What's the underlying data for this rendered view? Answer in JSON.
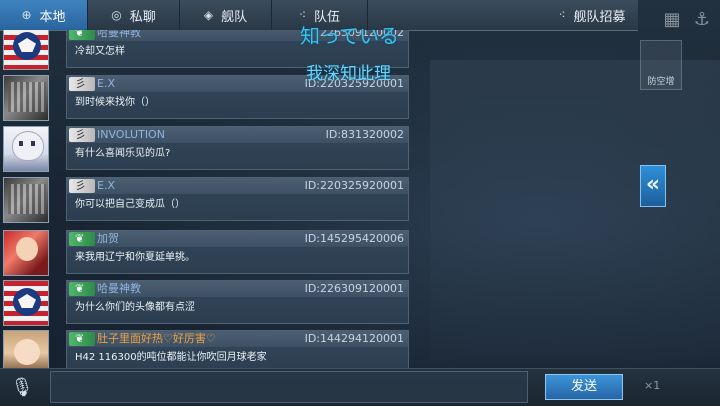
{
  "tabs": [
    {
      "label": "本地",
      "icon": "globe-icon",
      "active": true
    },
    {
      "label": "私聊",
      "icon": "chat-bubble-icon",
      "active": false
    },
    {
      "label": "舰队",
      "icon": "fleet-icon",
      "active": false
    },
    {
      "label": "队伍",
      "icon": "team-icon",
      "active": false
    },
    {
      "label": "舰队招募",
      "icon": "recruit-icon",
      "active": false
    }
  ],
  "overlay": {
    "line1": "知っている",
    "line2": "我深知此理"
  },
  "messages": [
    {
      "name": "哈曼神教",
      "id": "226309120002",
      "text": "冷却又怎样",
      "badge": "green",
      "avatar": "flag",
      "name_color": "blue"
    },
    {
      "name": "E.X",
      "id": "ID:220325920001",
      "text": "到时候来找你（）",
      "badge": "white",
      "avatar": "photo",
      "name_color": "blue"
    },
    {
      "name": "INVOLUTION",
      "id": "ID:831320002",
      "text": "有什么喜闻乐见的瓜?",
      "badge": "white",
      "avatar": "anime",
      "name_color": "blue"
    },
    {
      "name": "E.X",
      "id": "ID:220325920001",
      "text": "你可以把自己变成瓜（）",
      "badge": "white",
      "avatar": "photo",
      "name_color": "blue"
    },
    {
      "name": "加贺",
      "id": "ID:145295420006",
      "text": "来我用辽宁和你夏延单挑。",
      "badge": "green",
      "avatar": "red",
      "name_color": "blue"
    },
    {
      "name": "哈曼神教",
      "id": "ID:226309120001",
      "text": "为什么你们的头像都有点涩",
      "badge": "green",
      "avatar": "flag",
      "name_color": "blue"
    },
    {
      "name": "肚子里面好热♡好厉害♡",
      "id": "ID:144294120001",
      "text": "H42 116300的吨位都能让你吹回月球老家",
      "badge": "green",
      "avatar": "girl",
      "name_color": "orange"
    }
  ],
  "side": {
    "collapse_glyph": "«",
    "panel_label": "防空增"
  },
  "input": {
    "placeholder": "",
    "value": ""
  },
  "send_label": "发送",
  "multiplier": "×1",
  "colors": {
    "active_tab": "#2a64a0",
    "bubble_bg": "#2c3e50",
    "accent_blue": "#38c0f0",
    "name_blue": "#8fb4e0",
    "name_orange": "#f0a040"
  }
}
